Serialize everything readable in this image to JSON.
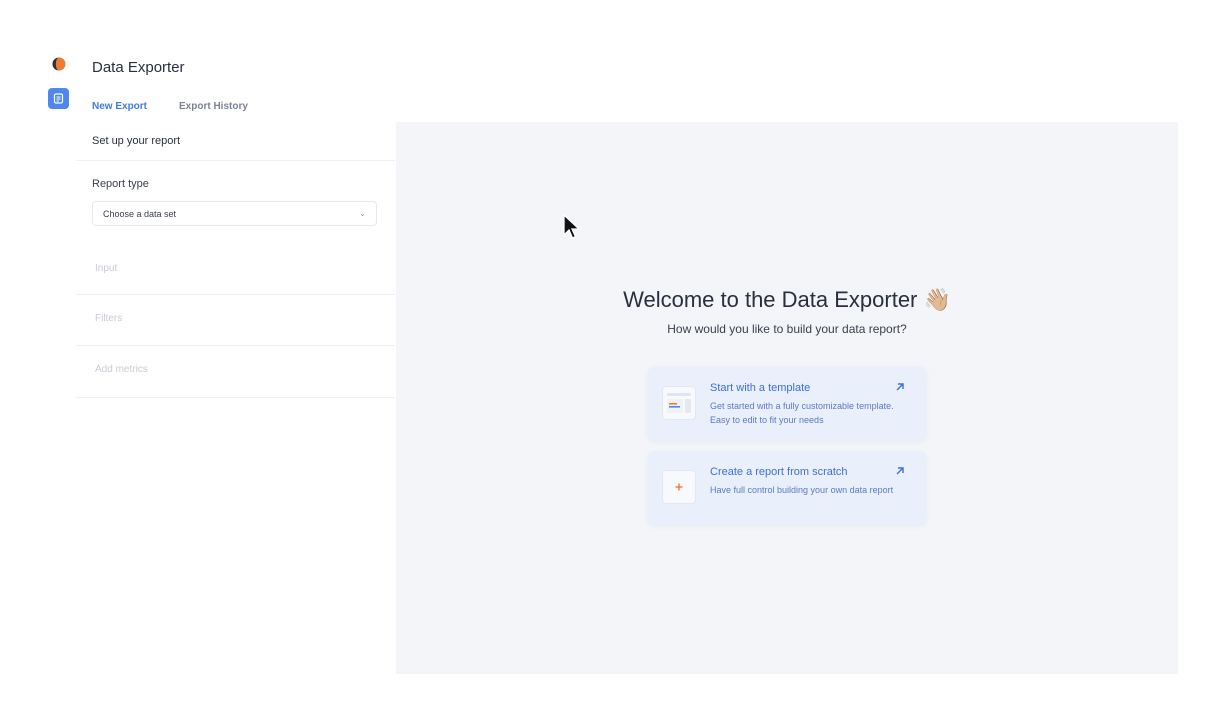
{
  "app": {
    "title": "Data Exporter"
  },
  "tabs": [
    {
      "label": "New Export",
      "active": true
    },
    {
      "label": "Export History",
      "active": false
    }
  ],
  "left_panel": {
    "section_title": "Set up your report",
    "report_type_label": "Report type",
    "report_type_select": {
      "value": "Choose a data set"
    },
    "steps": [
      "Input",
      "Filters",
      "Add metrics"
    ]
  },
  "main": {
    "welcome_title": "Welcome to the Data Exporter 👋🏼",
    "subtitle": "How would you like to build your data report?",
    "cards": [
      {
        "title": "Start with a template",
        "description": "Get started with a fully customizable template. Easy to edit to fit your needs",
        "icon": "template-thumbnail-icon"
      },
      {
        "title": "Create a report from scratch",
        "description": "Have full control building your own data report",
        "icon": "plus-icon"
      }
    ]
  },
  "colors": {
    "accent": "#3f7ae8",
    "rail_button": "#4f86f0",
    "main_bg": "#f3f5f9",
    "card_bg": "#e9effb",
    "logo_orange": "#f07a2e",
    "logo_dark": "#2b2f3a"
  }
}
